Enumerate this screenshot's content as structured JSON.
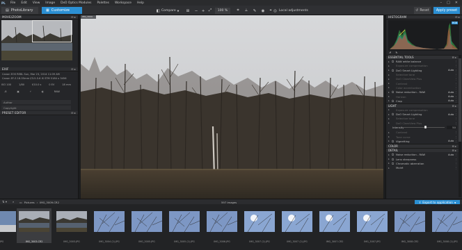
{
  "menubar": {
    "logo": "PL",
    "items": [
      "File",
      "Edit",
      "View",
      "Image",
      "DxO Optics Modules",
      "Palettes",
      "Workspace",
      "Help"
    ]
  },
  "toolbar": {
    "tab_library": "PhotoLibrary",
    "tab_customize": "Customize",
    "compare": "Compare",
    "zoom": "100 %",
    "local_adjustments": "Local adjustments",
    "reset": "Reset",
    "apply_preset": "Apply preset"
  },
  "left": {
    "navigator_title": "MOVE/ZOOM",
    "exif_title": "EXIF",
    "exif_line1": "Canon EOS REBL    Sun, Mar 23, 2014 11:09 AM",
    "exif_line2": "Canon EF-S 18-55mm f/3.5-5.6 IS STM   5184 x 3456",
    "exif_row": [
      "ISO 100",
      "1/80",
      "f/10.0 s",
      "0 EV",
      "18 mm"
    ],
    "exif_icons_row": [
      "-8",
      "RAW"
    ],
    "author_label": "Author",
    "copyright_label": "Copyright",
    "preset_editor_title": "PRESET EDITOR"
  },
  "viewer": {
    "corner_label": "IMG_3009"
  },
  "right": {
    "histogram_title": "HISTOGRAM",
    "histogram_badge": "RGB",
    "essential_title": "ESSENTIAL TOOLS",
    "essential_rows": [
      {
        "label": "RAW white balance",
        "auto": "",
        "dim": false,
        "power": true
      },
      {
        "label": "Exposure compensation",
        "auto": "",
        "dim": true,
        "power": false
      },
      {
        "label": "DxO Smart Lighting",
        "auto": "Auto",
        "dim": false,
        "power": true
      },
      {
        "label": "Selective tone",
        "auto": "",
        "dim": true,
        "power": false
      },
      {
        "label": "DxO ClearView Plus",
        "auto": "",
        "dim": true,
        "power": false
      },
      {
        "label": "Contrast",
        "auto": "",
        "dim": true,
        "power": false
      },
      {
        "label": "Color accentuation",
        "auto": "",
        "dim": true,
        "power": false
      },
      {
        "label": "Noise reduction - RAW",
        "auto": "Auto",
        "dim": false,
        "power": true
      },
      {
        "label": "Horizon",
        "auto": "Auto",
        "dim": true,
        "power": false
      },
      {
        "label": "Crop",
        "auto": "Auto",
        "dim": false,
        "power": true
      }
    ],
    "light_title": "LIGHT",
    "light_rows": [
      {
        "label": "Exposure compensation",
        "auto": "",
        "dim": true,
        "power": false
      },
      {
        "label": "DxO Smart Lighting",
        "auto": "Auto",
        "dim": false,
        "power": true
      },
      {
        "label": "Selective tone",
        "auto": "",
        "dim": true,
        "power": false
      },
      {
        "label": "DxO ClearView Plus",
        "auto": "",
        "dim": true,
        "power": false
      }
    ],
    "intensity_label": "Intensity",
    "intensity_value": "50",
    "intensity_fraction": 0.5,
    "light_rows2": [
      {
        "label": "Contrast",
        "auto": "",
        "dim": true,
        "power": false
      },
      {
        "label": "Tone curve",
        "auto": "",
        "dim": true,
        "power": false
      },
      {
        "label": "Vignetting",
        "auto": "Auto",
        "dim": false,
        "power": true
      }
    ],
    "color_title": "COLOR",
    "detail_title": "DETAIL",
    "detail_rows": [
      {
        "label": "Noise reduction - RAW",
        "auto": "Auto",
        "dim": false,
        "power": true
      },
      {
        "label": "Lens sharpness",
        "auto": "",
        "dim": false,
        "power": true
      },
      {
        "label": "Chromatic aberration",
        "auto": "",
        "dim": false,
        "power": true
      },
      {
        "label": "Moiré",
        "auto": "",
        "dim": false,
        "power": false
      }
    ]
  },
  "browser": {
    "path_root": "Pictures",
    "path_leaf": "IMG_3009.CR2",
    "count": "597 images",
    "export": "Export to application"
  },
  "filmstrip": [
    {
      "name": "s.JPG",
      "selected": false,
      "style": "sky"
    },
    {
      "name": "IMG_3003.CR2",
      "selected": true,
      "style": "pond"
    },
    {
      "name": "IMG_3003.JPG",
      "selected": false,
      "style": "pond"
    },
    {
      "name": "IMG_3004 (2).JPG",
      "selected": false,
      "style": "branch"
    },
    {
      "name": "IMG_3005.JPG",
      "selected": false,
      "style": "branch"
    },
    {
      "name": "IMG_3005 (2).JPG",
      "selected": false,
      "style": "branch"
    },
    {
      "name": "IMG_3006.JPG",
      "selected": false,
      "style": "branch"
    },
    {
      "name": "IMG_3007 (2).JPG",
      "selected": false,
      "style": "sun"
    },
    {
      "name": "IMG_3007 (2).JPG",
      "selected": false,
      "style": "sun"
    },
    {
      "name": "IMG_3007.CR2",
      "selected": false,
      "style": "sun"
    },
    {
      "name": "IMG_3007.JPG",
      "selected": false,
      "style": "sun"
    },
    {
      "name": "IMG_3008.CR2",
      "selected": false,
      "style": "branch"
    },
    {
      "name": "IMG_3008 (2).JPG",
      "selected": false,
      "style": "branch"
    }
  ],
  "colors": {
    "accent": "#2b8fd3",
    "panel": "#252629",
    "background": "#1e1f21"
  }
}
